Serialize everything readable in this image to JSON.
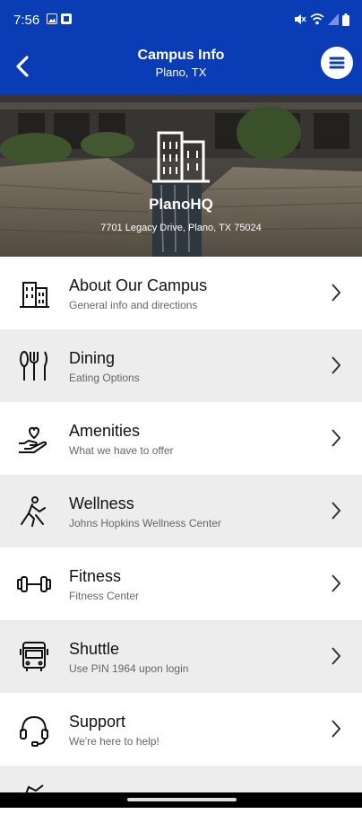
{
  "status_bar": {
    "time": "7:56"
  },
  "header": {
    "title": "Campus Info",
    "subtitle": "Plano, TX"
  },
  "hero": {
    "name": "PlanoHQ",
    "address": "7701 Legacy Drive, Plano, TX 75024"
  },
  "items": [
    {
      "label": "About Our Campus",
      "sub": "General info and directions",
      "icon": "building-icon"
    },
    {
      "label": "Dining",
      "sub": "Eating Options",
      "icon": "utensils-icon"
    },
    {
      "label": "Amenities",
      "sub": "What we have to offer",
      "icon": "heart-hand-icon"
    },
    {
      "label": "Wellness",
      "sub": "Johns Hopkins Wellness Center",
      "icon": "wellness-icon"
    },
    {
      "label": "Fitness",
      "sub": "Fitness Center",
      "icon": "dumbbell-icon"
    },
    {
      "label": "Shuttle",
      "sub": "Use PIN 1964 upon login",
      "icon": "bus-icon"
    },
    {
      "label": "Support",
      "sub": "We're here to help!",
      "icon": "headset-icon"
    }
  ],
  "colors": {
    "brand": "#0a3db5",
    "row_alt": "#ededed"
  }
}
